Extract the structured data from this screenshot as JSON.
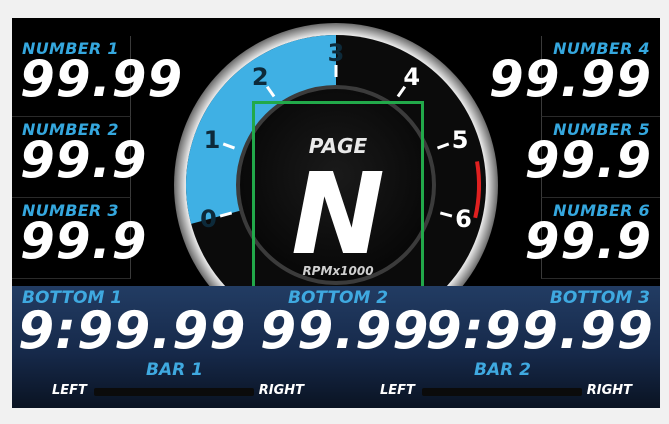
{
  "left_cells": [
    {
      "label": "NUMBER 1",
      "value": "99.99"
    },
    {
      "label": "NUMBER 2",
      "value": "99.9"
    },
    {
      "label": "NUMBER 3",
      "value": "99.9"
    }
  ],
  "right_cells": [
    {
      "label": "NUMBER 4",
      "value": "99.99"
    },
    {
      "label": "NUMBER 5",
      "value": "99.9"
    },
    {
      "label": "NUMBER 6",
      "value": "99.9"
    }
  ],
  "gauge": {
    "ticks": [
      "0",
      "1",
      "2",
      "3",
      "4",
      "5",
      "6"
    ],
    "rpm_fill_value": 3,
    "redline_start": 5.3,
    "page_label": "PAGE",
    "gear": "N",
    "unit_label": "RPMx1000",
    "colors": {
      "fill": "#3fb0e4",
      "redline": "#e02020",
      "ring": "#c8c8c8"
    }
  },
  "bottom": [
    {
      "label": "BOTTOM 1",
      "value": "9:99.99"
    },
    {
      "label": "BOTTOM 2",
      "value": "99.99"
    },
    {
      "label": "BOTTOM 3",
      "value": "9:99.99"
    }
  ],
  "bars": [
    {
      "label": "BAR 1",
      "left": "LEFT",
      "right": "RIGHT",
      "level": 0
    },
    {
      "label": "BAR 2",
      "left": "LEFT",
      "right": "RIGHT",
      "level": 0
    }
  ]
}
